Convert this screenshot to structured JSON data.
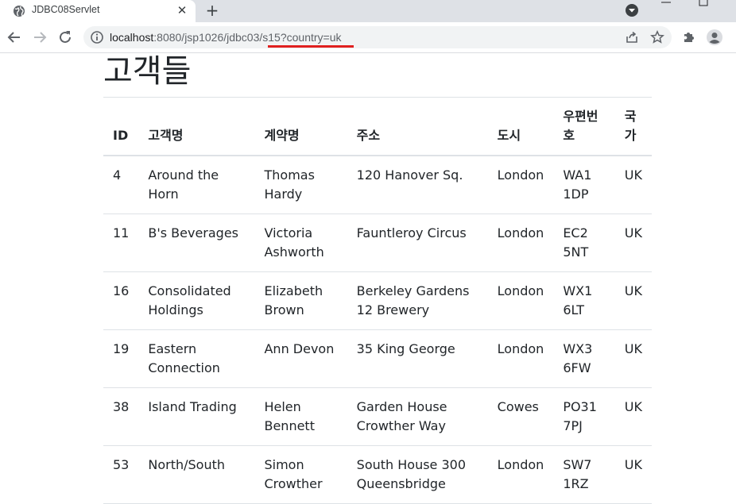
{
  "browser": {
    "tab_title": "JDBC08Servlet",
    "url_host": "localhost",
    "url_rest": ":8080/jsp1026/jdbc03/s15?country=uk"
  },
  "page": {
    "title": "고객들"
  },
  "table": {
    "headers": {
      "id": "ID",
      "name": "고객명",
      "contact": "계약명",
      "address": "주소",
      "city": "도시",
      "zip": "우편번호",
      "country": "국가"
    },
    "rows": [
      {
        "id": "4",
        "name": "Around the Horn",
        "contact": "Thomas Hardy",
        "address": "120 Hanover Sq.",
        "city": "London",
        "zip": "WA1 1DP",
        "country": "UK"
      },
      {
        "id": "11",
        "name": "B's Beverages",
        "contact": "Victoria Ashworth",
        "address": "Fauntleroy Circus",
        "city": "London",
        "zip": "EC2 5NT",
        "country": "UK"
      },
      {
        "id": "16",
        "name": "Consolidated Holdings",
        "contact": "Elizabeth Brown",
        "address": "Berkeley Gardens 12 Brewery",
        "city": "London",
        "zip": "WX1 6LT",
        "country": "UK"
      },
      {
        "id": "19",
        "name": "Eastern Connection",
        "contact": "Ann Devon",
        "address": "35 King George",
        "city": "London",
        "zip": "WX3 6FW",
        "country": "UK"
      },
      {
        "id": "38",
        "name": "Island Trading",
        "contact": "Helen Bennett",
        "address": "Garden House Crowther Way",
        "city": "Cowes",
        "zip": "PO31 7PJ",
        "country": "UK"
      },
      {
        "id": "53",
        "name": "North/South",
        "contact": "Simon Crowther",
        "address": "South House 300 Queensbridge",
        "city": "London",
        "zip": "SW7 1RZ",
        "country": "UK"
      }
    ]
  },
  "icons": {
    "tab_favicon": "globe-icon",
    "tab_close": "close-icon",
    "new_tab": "plus-icon",
    "tab_search": "chevron-down-circle-icon",
    "back": "arrow-left-icon",
    "forward": "arrow-right-icon",
    "reload": "reload-icon",
    "site_info": "info-icon",
    "share": "share-icon",
    "bookmark": "star-icon",
    "extensions": "puzzle-icon",
    "profile": "profile-icon"
  },
  "colors": {
    "tabstrip_bg": "#dee1e6",
    "omnibox_bg": "#f1f3f4",
    "annotation_red": "#e0201f",
    "table_border": "#dee2e6",
    "text": "#212529"
  }
}
